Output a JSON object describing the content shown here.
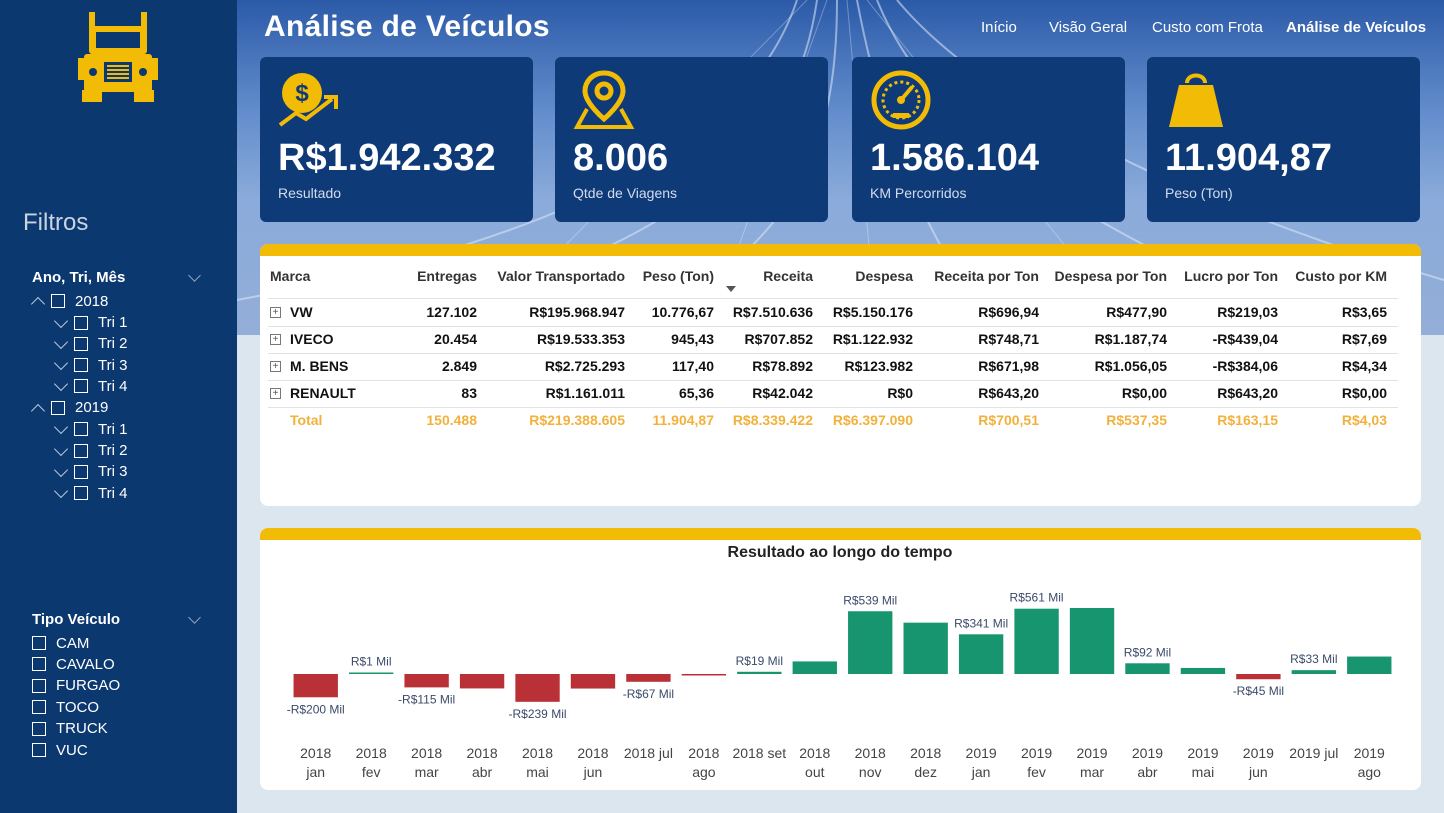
{
  "header": {
    "title": "Análise de Veículos",
    "nav": [
      "Início",
      "Visão Geral",
      "Custo com Frota",
      "Análise de Veículos"
    ],
    "active_nav": "Análise de Veículos"
  },
  "sidebar": {
    "logo_icon": "truck-icon",
    "filters_title": "Filtros",
    "date_slicer": {
      "title": "Ano, Tri, Mês",
      "years": [
        {
          "label": "2018",
          "quarters": [
            "Tri 1",
            "Tri 2",
            "Tri 3",
            "Tri 4"
          ]
        },
        {
          "label": "2019",
          "quarters": [
            "Tri 1",
            "Tri 2",
            "Tri 3",
            "Tri 4"
          ]
        }
      ]
    },
    "vehicle_slicer": {
      "title": "Tipo Veículo",
      "items": [
        "CAM",
        "CAVALO",
        "FURGAO",
        "TOCO",
        "TRUCK",
        "VUC"
      ]
    }
  },
  "kpis": [
    {
      "value": "R$1.942.332",
      "label": "Resultado",
      "icon": "money-growth-icon"
    },
    {
      "value": "8.006",
      "label": "Qtde de Viagens",
      "icon": "map-pin-icon"
    },
    {
      "value": "1.586.104",
      "label": "KM Percorridos",
      "icon": "speedometer-icon"
    },
    {
      "value": "11.904,87",
      "label": "Peso (Ton)",
      "icon": "weight-icon"
    }
  ],
  "table": {
    "columns": [
      "Marca",
      "Entregas",
      "Valor Transportado",
      "Peso (Ton)",
      "Receita",
      "Despesa",
      "Receita por Ton",
      "Despesa por Ton",
      "Lucro por Ton",
      "Custo por KM"
    ],
    "rows": [
      [
        "VW",
        "127.102",
        "R$195.968.947",
        "10.776,67",
        "R$7.510.636",
        "R$5.150.176",
        "R$696,94",
        "R$477,90",
        "R$219,03",
        "R$3,65"
      ],
      [
        "IVECO",
        "20.454",
        "R$19.533.353",
        "945,43",
        "R$707.852",
        "R$1.122.932",
        "R$748,71",
        "R$1.187,74",
        "-R$439,04",
        "R$7,69"
      ],
      [
        "M. BENS",
        "2.849",
        "R$2.725.293",
        "117,40",
        "R$78.892",
        "R$123.982",
        "R$671,98",
        "R$1.056,05",
        "-R$384,06",
        "R$4,34"
      ],
      [
        "RENAULT",
        "83",
        "R$1.161.011",
        "65,36",
        "R$42.042",
        "R$0",
        "R$643,20",
        "R$0,00",
        "R$643,20",
        "R$0,00"
      ]
    ],
    "total": [
      "Total",
      "150.488",
      "R$219.388.605",
      "11.904,87",
      "R$8.339.422",
      "R$6.397.090",
      "R$700,51",
      "R$537,35",
      "R$163,15",
      "R$4,03"
    ]
  },
  "chart_data": {
    "type": "bar",
    "title": "Resultado ao longo do tempo",
    "categories": [
      "2018 jan",
      "2018 fev",
      "2018 mar",
      "2018 abr",
      "2018 mai",
      "2018 jun",
      "2018 jul",
      "2018 ago",
      "2018 set",
      "2018 out",
      "2018 nov",
      "2018 dez",
      "2019 jan",
      "2019 fev",
      "2019 mar",
      "2019 abr",
      "2019 mai",
      "2019 jun",
      "2019 jul",
      "2019 ago"
    ],
    "category_lines": [
      [
        "2018",
        "jan"
      ],
      [
        "2018",
        "fev"
      ],
      [
        "2018",
        "mar"
      ],
      [
        "2018",
        "abr"
      ],
      [
        "2018",
        "mai"
      ],
      [
        "2018",
        "jun"
      ],
      [
        "2018 jul",
        ""
      ],
      [
        "2018",
        "ago"
      ],
      [
        "2018 set",
        ""
      ],
      [
        "2018",
        "out"
      ],
      [
        "2018",
        "nov"
      ],
      [
        "2018",
        "dez"
      ],
      [
        "2019",
        "jan"
      ],
      [
        "2019",
        "fev"
      ],
      [
        "2019",
        "mar"
      ],
      [
        "2019",
        "abr"
      ],
      [
        "2019",
        "mai"
      ],
      [
        "2019",
        "jun"
      ],
      [
        "2019 jul",
        ""
      ],
      [
        "2019",
        "ago"
      ]
    ],
    "values": [
      -200,
      1,
      -115,
      -124,
      -239,
      -125,
      -67,
      -5,
      19,
      108,
      539,
      441,
      341,
      561,
      567,
      92,
      52,
      -45,
      33,
      150
    ],
    "unit": "Mil R$",
    "data_labels": [
      "-R$200 Mil",
      "R$1 Mil",
      "-R$115 Mil",
      "",
      "-R$239 Mil",
      "",
      "-R$67 Mil",
      "",
      "R$19 Mil",
      "",
      "R$539 Mil",
      "",
      "R$341 Mil",
      "R$561 Mil",
      "",
      "R$92 Mil",
      "",
      "-R$45 Mil",
      "R$33 Mil",
      ""
    ],
    "colors": {
      "positive": "#17956e",
      "negative": "#b93136"
    },
    "grid": false
  }
}
